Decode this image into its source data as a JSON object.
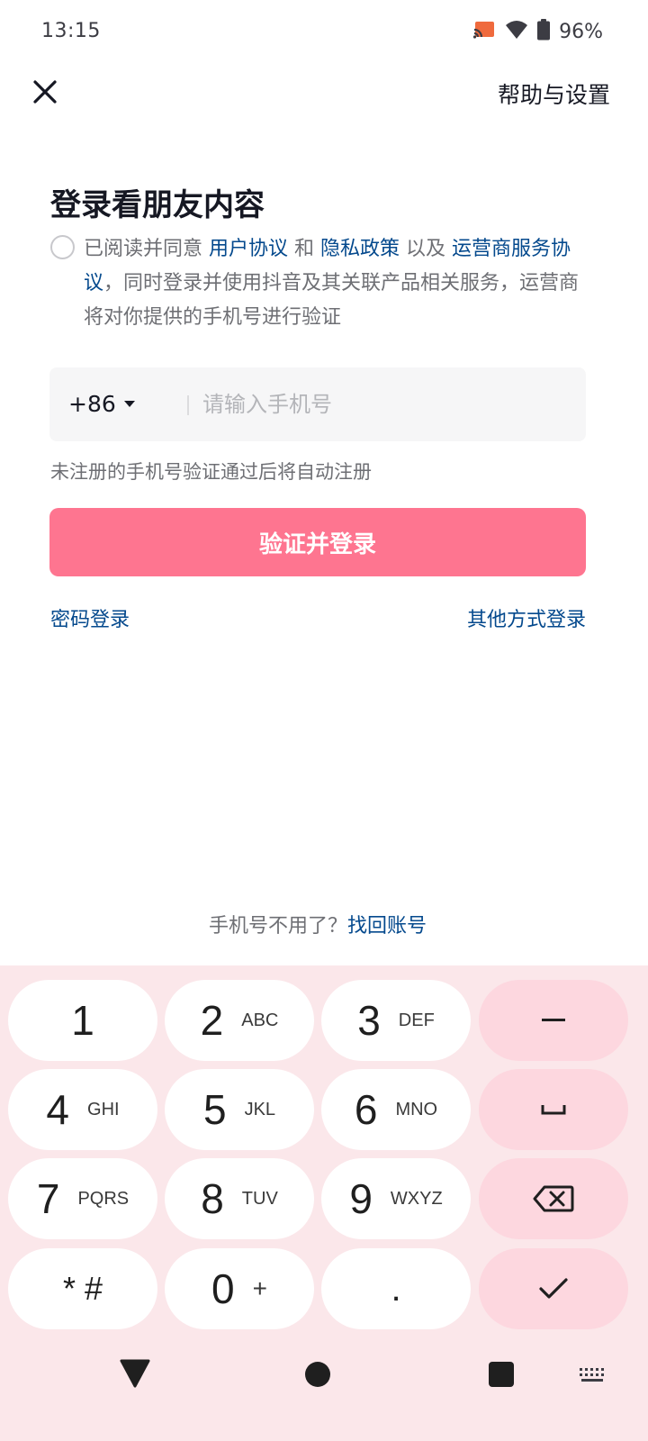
{
  "status_bar": {
    "time": "13:15",
    "battery_percent": "96%",
    "icons": [
      "cast-icon",
      "wifi-icon",
      "battery-icon"
    ]
  },
  "header": {
    "close_icon": "close-icon",
    "help_label": "帮助与设置"
  },
  "title": "登录看朋友内容",
  "agreement": {
    "checked": false,
    "prefix": "已阅读并同意 ",
    "user_agreement": "用户协议",
    "and": " 和 ",
    "privacy_policy": "隐私政策",
    "and2": " 以及 ",
    "carrier_agreement": "运营商服务协议",
    "suffix": "，同时登录并使用抖音及其关联产品相关服务，运营商将对你提供的手机号进行验证"
  },
  "phone": {
    "country_code": "+86",
    "placeholder": "请输入手机号",
    "value": ""
  },
  "hint": "未注册的手机号验证通过后将自动注册",
  "login_button": "验证并登录",
  "password_login": "密码登录",
  "other_login": "其他方式登录",
  "recover": {
    "question": "手机号不用了？",
    "link": "找回账号"
  },
  "keypad": {
    "keys": [
      {
        "digit": "1",
        "letters": ""
      },
      {
        "digit": "2",
        "letters": "ABC"
      },
      {
        "digit": "3",
        "letters": "DEF"
      },
      {
        "digit": "4",
        "letters": "GHI"
      },
      {
        "digit": "5",
        "letters": "JKL"
      },
      {
        "digit": "6",
        "letters": "MNO"
      },
      {
        "digit": "7",
        "letters": "PQRS"
      },
      {
        "digit": "8",
        "letters": "TUV"
      },
      {
        "digit": "9",
        "letters": "WXYZ"
      },
      {
        "digit": "* #",
        "letters": ""
      },
      {
        "digit": "0",
        "letters": "+"
      },
      {
        "digit": ".",
        "letters": ""
      }
    ],
    "actions": [
      "minus-icon",
      "space-icon",
      "backspace-icon",
      "checkmark-icon"
    ],
    "accent_color": "#fdd7df",
    "background_color": "#fbe7ea"
  },
  "nav_bar": {
    "icons": [
      "back-triangle-icon",
      "home-circle-icon",
      "recents-square-icon",
      "keyboard-switch-icon"
    ]
  },
  "colors": {
    "primary_button": "#fe7590",
    "link": "#04498d"
  }
}
